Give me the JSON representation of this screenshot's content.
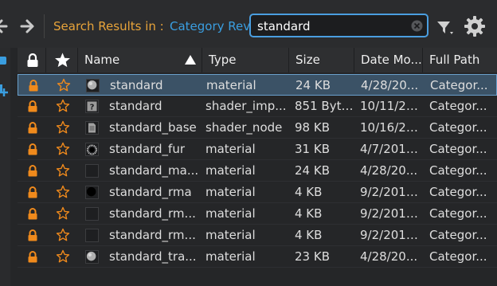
{
  "toolbar": {
    "search_label": "Search Results in :",
    "category": "Category Rev",
    "search_value": "standard"
  },
  "columns": [
    {
      "label": "",
      "icon": "lock-icon"
    },
    {
      "label": "",
      "icon": "star-icon"
    },
    {
      "label": "Name",
      "sort": "ascending"
    },
    {
      "label": "Type"
    },
    {
      "label": "Size"
    },
    {
      "label": "Date Mo..."
    },
    {
      "label": "Full Path"
    }
  ],
  "rows": [
    {
      "name": "standard",
      "type": "material",
      "size": "24 KB",
      "date": "4/28/20...",
      "path": "Categor...",
      "thumb": "sphere-gray",
      "selected": true
    },
    {
      "name": "standard",
      "type": "shader_imp...",
      "size": "851 Bytes",
      "date": "10/11/20...",
      "path": "Categor...",
      "thumb": "unknown"
    },
    {
      "name": "standard_base",
      "type": "shader_node",
      "size": "98 KB",
      "date": "10/16/20...",
      "path": "Categor...",
      "thumb": "document"
    },
    {
      "name": "standard_fur",
      "type": "material",
      "size": "31 KB",
      "date": "4/7/2016...",
      "path": "Categor...",
      "thumb": "fur"
    },
    {
      "name": "standard_ma...",
      "type": "material",
      "size": "24 KB",
      "date": "4/28/20...",
      "path": "Categor...",
      "thumb": "empty"
    },
    {
      "name": "standard_rma",
      "type": "material",
      "size": "4 KB",
      "date": "9/2/2016...",
      "path": "Categor...",
      "thumb": "sphere-black"
    },
    {
      "name": "standard_rm...",
      "type": "material",
      "size": "4 KB",
      "date": "9/2/2016...",
      "path": "Categor...",
      "thumb": "empty"
    },
    {
      "name": "standard_rm...",
      "type": "material",
      "size": "4 KB",
      "date": "9/2/2016...",
      "path": "Categor...",
      "thumb": "empty"
    },
    {
      "name": "standard_tra...",
      "type": "material",
      "size": "23 KB",
      "date": "4/28/20...",
      "path": "Categor...",
      "thumb": "sphere-gray"
    }
  ],
  "colors": {
    "accent_orange": "#f08a1c",
    "accent_blue": "#3a9ee0",
    "label_orange": "#e8a43a"
  }
}
